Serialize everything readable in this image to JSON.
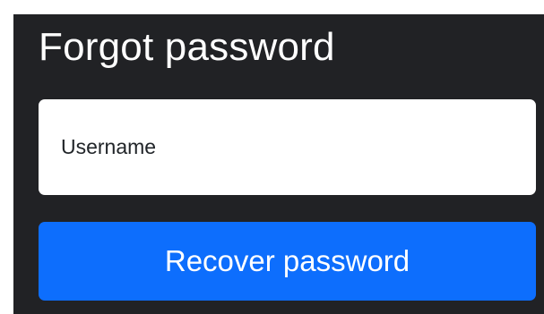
{
  "form": {
    "title": "Forgot password",
    "username_placeholder": "Username",
    "username_value": "",
    "submit_label": "Recover password"
  },
  "colors": {
    "panel_background": "#212225",
    "input_background": "#ffffff",
    "primary_button": "#0d6efd",
    "title_text": "#ffffff",
    "button_text": "#ffffff"
  }
}
